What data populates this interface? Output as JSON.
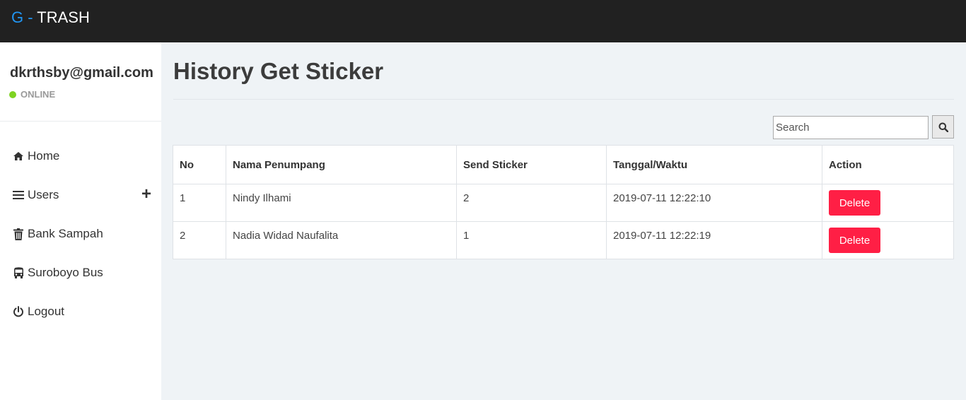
{
  "brand": {
    "prefix": "G -",
    "name": "TRASH"
  },
  "sidebar": {
    "email": "dkrthsby@gmail.com",
    "status": "ONLINE",
    "items": [
      {
        "label": "Home",
        "icon": "home-icon"
      },
      {
        "label": "Users",
        "icon": "menu-icon",
        "action": "+"
      },
      {
        "label": "Bank Sampah",
        "icon": "trash-icon"
      },
      {
        "label": "Suroboyo Bus",
        "icon": "bus-icon"
      },
      {
        "label": "Logout",
        "icon": "power-icon"
      }
    ]
  },
  "main": {
    "title": "History Get Sticker",
    "search": {
      "placeholder": "Search",
      "value": ""
    },
    "table": {
      "headers": [
        "No",
        "Nama Penumpang",
        "Send Sticker",
        "Tanggal/Waktu",
        "Action"
      ],
      "rows": [
        {
          "no": "1",
          "name": "Nindy Ilhami",
          "send": "2",
          "time": "2019-07-11 12:22:10",
          "action": "Delete"
        },
        {
          "no": "2",
          "name": "Nadia Widad Naufalita",
          "send": "1",
          "time": "2019-07-11 12:22:19",
          "action": "Delete"
        }
      ]
    }
  },
  "colors": {
    "topbar": "#212121",
    "brand_accent": "#2196f3",
    "online": "#7ed321",
    "delete": "#ff1f45",
    "background": "#eff3f6"
  }
}
